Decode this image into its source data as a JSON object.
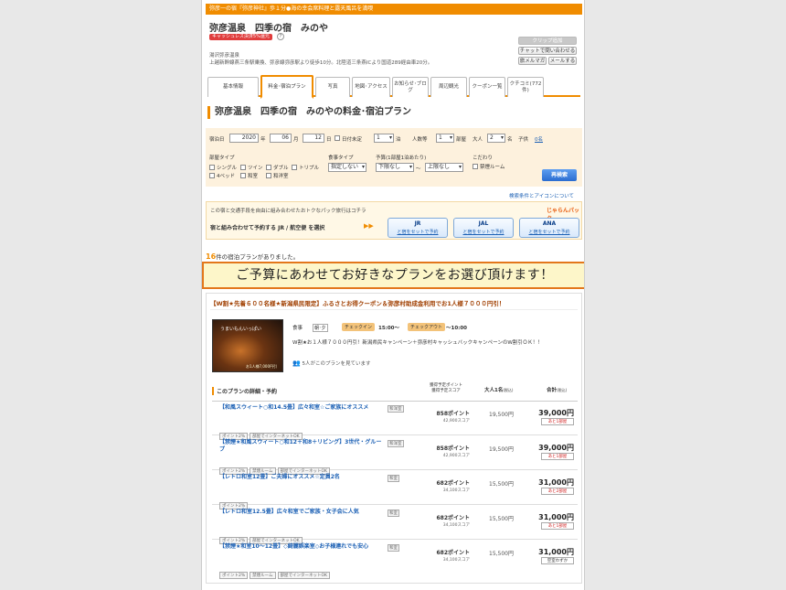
{
  "header": {
    "topbar_text": "弥彦一の宿『弥彦神社』歩１分●海の幸会席料理と露天風呂を満喫",
    "hotel_name": "弥彦温泉　四季の宿　みのや",
    "cashless_badge": "キャッシュレス決済5%還元",
    "question_icon": "?",
    "address_line1": "湯沢弥彦温泉",
    "address_line2": "上越新幹線燕三条駅乗換、弥彦線弥彦駅より徒歩10分。北陸道三条燕ICより国道289経由車20分。",
    "buttons": {
      "favorite": "クリップ追加",
      "chat": "チャットで問い合わせる",
      "magazine": "旅メルマガ",
      "mail": "メールする"
    }
  },
  "tabs": [
    {
      "label": "基本情報"
    },
    {
      "label": "料金･宿泊プラン"
    },
    {
      "label": "写真"
    },
    {
      "label": "地図･アクセス"
    },
    {
      "label": "お知らせ･ブログ"
    },
    {
      "label": "周辺観光"
    },
    {
      "label": "クーポン一覧"
    },
    {
      "label": "クチコミ(772件)"
    }
  ],
  "section_title": "弥彦温泉　四季の宿　みのやの料金･宿泊プラン",
  "search": {
    "checkin_label": "宿泊日",
    "year": "2020",
    "year_unit": "年",
    "month": "06",
    "month_unit": "月",
    "day": "12",
    "day_unit": "日",
    "date_undecided": "日付未定",
    "nights": "1",
    "nights_unit": "泊",
    "people_label": "人数等",
    "rooms": "1",
    "rooms_unit": "部屋",
    "adults_label": "大人",
    "adults": "2",
    "adults_unit": "名",
    "children_label": "子供",
    "children_value": "0名",
    "room_type_label": "部屋タイプ",
    "room_types": [
      "シングル",
      "ツイン",
      "ダブル",
      "トリプル",
      "4ベッド",
      "和室",
      "和洋室"
    ],
    "meal_label": "食事タイプ",
    "meal_value": "指定しない",
    "budget_label": "予算(1部屋1泊あたり)",
    "budget_min": "下限なし",
    "budget_sep": "～",
    "budget_max": "上限なし",
    "preference_label": "こだわり",
    "preference_item": "禁煙ルーム",
    "search_button": "再検索",
    "help_link": "検索条件とアイコンについて"
  },
  "package": {
    "intro": "この宿と交通手段を自由に組み合わせたおトクなパック旅行はコチラ",
    "cta": "宿と組み合わせて予約する JR / 航空便 を選択",
    "logo": "じゃらんパック",
    "options": [
      {
        "name": "JR",
        "sub": "と宿をセットで予約"
      },
      {
        "name": "JAL",
        "sub": "と宿をセットで予約"
      },
      {
        "name": "ANA",
        "sub": "と宿をセットで予約"
      }
    ]
  },
  "result": {
    "count": "16",
    "suffix": "件の宿泊プランがありました。"
  },
  "banner": "ご予算にあわせてお好きなプランをお選び頂けます！",
  "plan": {
    "title": "【W割★先着６００名様★新潟県民限定】ふるさとお得クーポン＆弥彦村助成金利用でお1人様７０００円引！",
    "image_text": "うまいもんいっぱい",
    "image_sub": "お1人様7,000円引",
    "meal_label": "食事",
    "meal_value": "朝･夕",
    "checkin_label": "チェックイン",
    "checkin_value": "15:00〜",
    "checkout_label": "チェックアウト",
    "checkout_value": "〜10:00",
    "description": "W割★お１人様７０００円引！新潟県民キャンペーン＋弥彦村キャッシュバックキャンペーンのW割引ＯＫ！！",
    "viewers": "5人がこのプランを見ています",
    "list_title": "このプランの詳細・予約",
    "col_points": "獲得予定ポイント",
    "col_score": "獲得予定スコア",
    "col_adult": "大人1名",
    "col_adult_note": "(税込)",
    "col_total": "合計",
    "col_total_note": "(税込)",
    "rooms": [
      {
        "name": "【和風スウィート○和14.5畳】広々和室☆ご家族にオススメ",
        "room": "和洋室",
        "tags": [
          "ポイント2%",
          "部屋でインターネットOK"
        ],
        "points": "858ポイント",
        "score": "42,900スコア",
        "adult": "19,500円",
        "total": "39,000円",
        "left": "あと1部屋",
        "left_red": true
      },
      {
        "name": "【禁煙★和風スウィート○和12＋和8＋リビング】3世代・グループ",
        "room": "和洋室",
        "tags": [
          "ポイント2%",
          "禁煙ルーム",
          "部屋でインターネットOK"
        ],
        "points": "858ポイント",
        "score": "42,900スコア",
        "adult": "19,500円",
        "total": "39,000円",
        "left": "あと1部屋",
        "left_red": true
      },
      {
        "name": "【レトロ和室12畳】ご夫婦にオススメ☆定員2名",
        "room": "和室",
        "tags": [
          "ポイント2%"
        ],
        "points": "682ポイント",
        "score": "34,100スコア",
        "adult": "15,500円",
        "total": "31,000円",
        "left": "あと2部屋",
        "left_red": true
      },
      {
        "name": "【レトロ和室12.5畳】広々和室でご家族・女子会に人気",
        "room": "和室",
        "tags": [
          "ポイント2%",
          "部屋でインターネットOK"
        ],
        "points": "682ポイント",
        "score": "34,100スコア",
        "adult": "15,500円",
        "total": "31,000円",
        "left": "あと1部屋",
        "left_red": true
      },
      {
        "name": "【禁煙★和室10～12畳】◇綺麗娯楽室◇お子様連れでも安心",
        "room": "和室",
        "tags": [
          "ポイント2%",
          "禁煙ルーム",
          "部屋でインターネットOK"
        ],
        "points": "682ポイント",
        "score": "34,100スコア",
        "adult": "15,500円",
        "total": "31,000円",
        "left": "空室わずか",
        "left_red": false
      }
    ]
  }
}
